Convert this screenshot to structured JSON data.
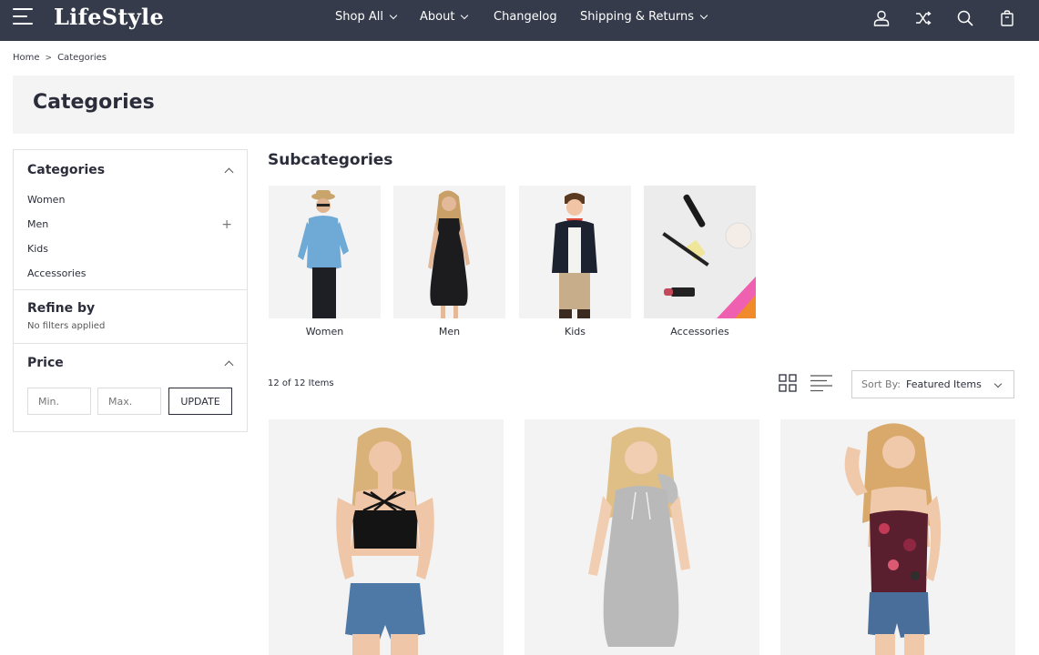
{
  "header": {
    "logo": "LifeStyle",
    "nav": [
      {
        "label": "Shop All",
        "dropdown": true
      },
      {
        "label": "About",
        "dropdown": true
      },
      {
        "label": "Changelog",
        "dropdown": false
      },
      {
        "label": "Shipping & Returns",
        "dropdown": true
      }
    ],
    "icons": [
      "user-icon",
      "shuffle-icon",
      "search-icon",
      "shopping-bag-icon"
    ]
  },
  "breadcrumb": {
    "home": "Home",
    "separator": ">",
    "current": "Categories"
  },
  "page": {
    "title": "Categories"
  },
  "sidebar": {
    "categories_title": "Categories",
    "items": [
      {
        "label": "Women"
      },
      {
        "label": "Men"
      },
      {
        "label": "Kids"
      },
      {
        "label": "Accessories"
      }
    ],
    "refine_title": "Refine by",
    "refine_subtitle": "No filters applied",
    "price_title": "Price",
    "min_placeholder": "Min.",
    "max_placeholder": "Max.",
    "update_label": "UPDATE"
  },
  "subcategories": {
    "heading": "Subcategories",
    "items": [
      {
        "label": "Women"
      },
      {
        "label": "Men"
      },
      {
        "label": "Kids"
      },
      {
        "label": "Accessories"
      }
    ]
  },
  "toolbar": {
    "count": "12 of 12 Items",
    "sort_label": "Sort By:",
    "sort_value": "Featured Items"
  },
  "products": [
    {
      "name": "black-crop-top-product"
    },
    {
      "name": "grey-hoodie-dress-product"
    },
    {
      "name": "floral-lace-bodysuit-product"
    }
  ],
  "colors": {
    "header_bg": "#353b4a",
    "title_band": "#f4f4f4",
    "image_bg": "#f3f3f3"
  }
}
